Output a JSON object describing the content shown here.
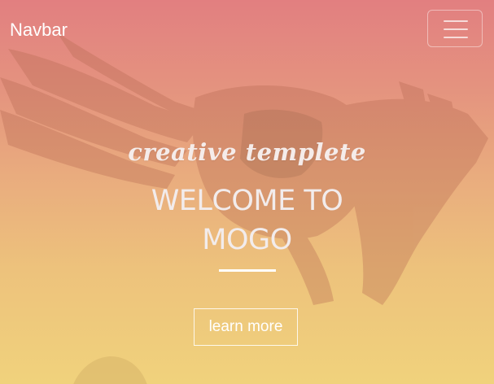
{
  "navbar": {
    "brand": "Navbar",
    "toggler_icon": "hamburger-menu-icon"
  },
  "intro": {
    "suptitle": "creative templete",
    "title": "WELCOME TO MOGO",
    "cta_label": "learn more"
  },
  "colors": {
    "gradient_top": "#e27f80",
    "gradient_bottom": "#f0d27c",
    "text": "#ffffff"
  },
  "decorative_image": "eagle-in-flight"
}
